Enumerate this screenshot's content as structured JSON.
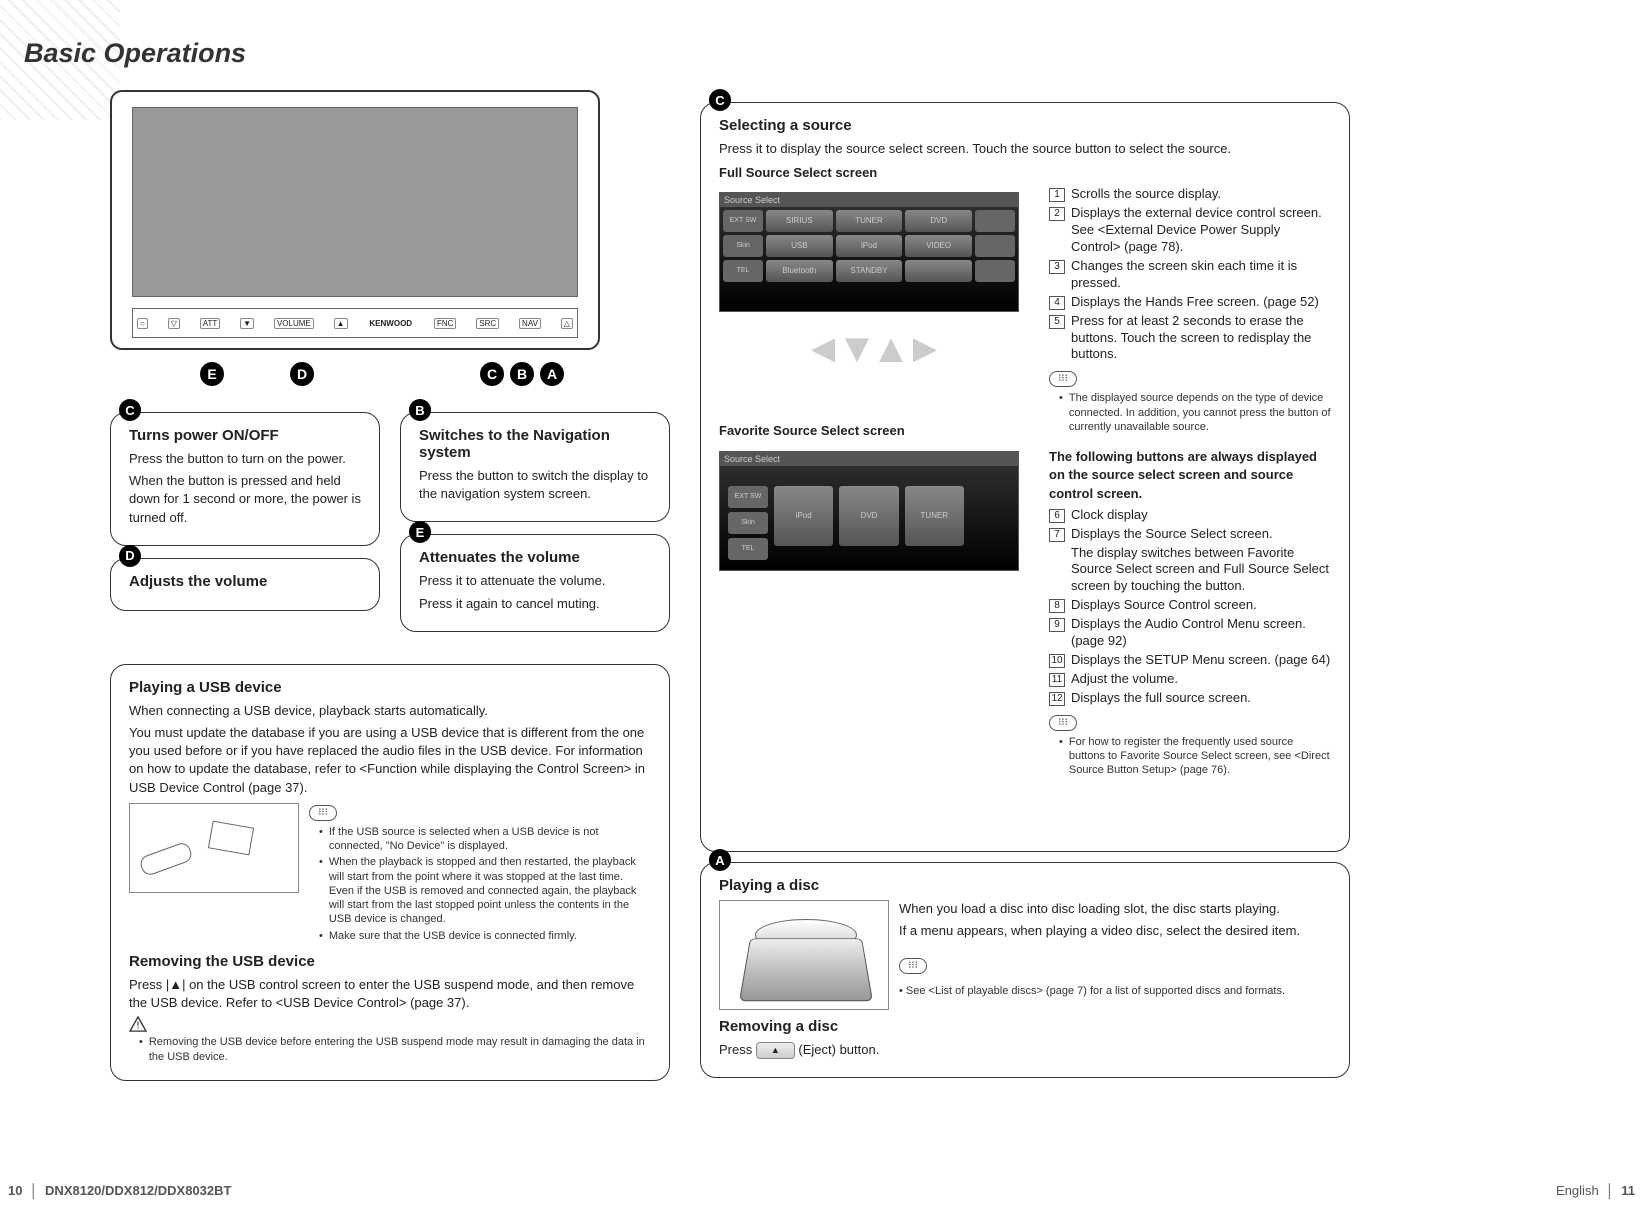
{
  "title": "Basic Operations",
  "device": {
    "brand": "KENWOOD",
    "btns": [
      "○",
      "▽",
      "ATT",
      "▼",
      "VOLUME",
      "▲",
      "FNC",
      "SRC",
      "NAV",
      "△"
    ]
  },
  "callouts": [
    "E",
    "D",
    "C",
    "B",
    "A"
  ],
  "box_c": {
    "label": "C",
    "title": "Turns power ON/OFF",
    "p1": "Press the button to turn on the power.",
    "p2": "When the button is pressed and held down for 1 second or more, the power is turned off."
  },
  "box_b": {
    "label": "B",
    "title": "Switches to the Navigation system",
    "p1": "Press the button to switch the display to the navigation system screen."
  },
  "box_d": {
    "label": "D",
    "title": "Adjusts the volume"
  },
  "box_e": {
    "label": "E",
    "title": "Attenuates the volume",
    "p1": "Press it to attenuate the volume.",
    "p2": "Press it again to cancel muting."
  },
  "usb": {
    "title": "Playing a USB device",
    "p1": "When connecting a USB device, playback starts automatically.",
    "p2": "You must update the database if you are using a USB device that is different from the one you used before or if you have replaced the audio files in the USB device. For information on how to update the database, refer to <Function while displaying the Control Screen> in USB Device Control (page 37).",
    "notes": [
      "If the USB source is selected when a USB device is not connected, \"No Device\" is displayed.",
      "When the playback is stopped and then restarted, the playback will start from the point where it was stopped at the last time. Even if the USB is removed and connected again, the playback will start from the last stopped point unless the contents in the USB device is changed.",
      "Make sure that the USB device is connected firmly."
    ],
    "rem_title": "Removing the USB device",
    "rem_p": "Press |▲| on the USB control screen to enter the USB suspend mode, and then remove the USB device. Refer to <USB Device Control> (page 37).",
    "warn": "Removing the USB device before entering the USB suspend mode may result in damaging the data in the USB device."
  },
  "sel": {
    "label": "C",
    "title": "Selecting a source",
    "sub": "Press it to display the source select screen. Touch the source button to select the source.",
    "full_hdr": "Full Source Select screen",
    "fav_hdr": "Favorite Source Select screen",
    "screen_hdr": "Source Select",
    "cells": [
      "SIRIUS",
      "TUNER",
      "DVD",
      "USB",
      "iPod",
      "VIDEO",
      "Bluetooth",
      "STANDBY",
      ""
    ],
    "sides_l": [
      "EXT SW",
      "Skin",
      "TEL"
    ],
    "items": [
      {
        "n": "1",
        "t": "Scrolls the source display."
      },
      {
        "n": "2",
        "t": "Displays the external device control screen. See <External Device Power Supply Control> (page 78)."
      },
      {
        "n": "3",
        "t": "Changes the screen skin each time it is pressed."
      },
      {
        "n": "4",
        "t": "Displays the Hands Free screen. (page 52)"
      },
      {
        "n": "5",
        "t": "Press for at least 2 seconds to erase the buttons. Touch the screen to redisplay the buttons."
      }
    ],
    "note1": "The displayed source depends on the type of device connected. In addition, you cannot press the button of currently unavailable source.",
    "mid": "The following buttons are always displayed on the source select screen and source control screen.",
    "items2": [
      {
        "n": "6",
        "t": "Clock display"
      },
      {
        "n": "7",
        "t": "Displays the Source Select screen."
      },
      {
        "n": "7b",
        "t": "The display switches between Favorite Source Select screen and Full Source Select screen by touching the button."
      },
      {
        "n": "8",
        "t": "Displays Source Control screen."
      },
      {
        "n": "9",
        "t": "Displays the Audio Control Menu screen. (page 92)"
      },
      {
        "n": "10",
        "t": "Displays the SETUP Menu screen. (page 64)"
      },
      {
        "n": "11",
        "t": "Adjust the volume."
      },
      {
        "n": "12",
        "t": "Displays the full source screen."
      }
    ],
    "note2": "For how to register the frequently used source buttons to Favorite Source Select screen, see <Direct Source Button Setup> (page 76).",
    "fav_cells": [
      "iPod",
      "DVD",
      "TUNER"
    ]
  },
  "disc": {
    "label": "A",
    "title": "Playing a disc",
    "p1": "When you load a disc into disc loading slot, the disc starts playing.",
    "p2": "If a menu appears, when playing a video disc, select the desired item.",
    "note": "• See <List of playable discs> (page 7) for a list of supported discs and formats.",
    "rem_title": "Removing a disc",
    "rem_p": "Press",
    "rem_p2": "(Eject) button."
  },
  "footer": {
    "left_num": "10",
    "left_txt": "DNX8120/DDX812/DDX8032BT",
    "right_txt": "English",
    "right_num": "11"
  }
}
